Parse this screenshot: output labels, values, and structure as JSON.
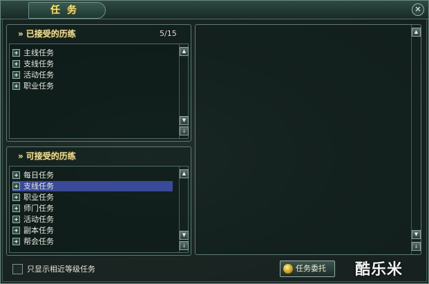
{
  "window": {
    "title": "任务"
  },
  "accepted": {
    "header": "已接受的历练",
    "count": "5/15",
    "items": [
      {
        "label": "主线任务"
      },
      {
        "label": "支线任务"
      },
      {
        "label": "活动任务"
      },
      {
        "label": "职业任务"
      }
    ]
  },
  "available": {
    "header": "可接受的历练",
    "items": [
      {
        "label": "每日任务"
      },
      {
        "label": "支线任务"
      },
      {
        "label": "职业任务"
      },
      {
        "label": "师门任务"
      },
      {
        "label": "活动任务"
      },
      {
        "label": "副本任务"
      },
      {
        "label": "帮会任务"
      }
    ],
    "selected_index": 1
  },
  "footer": {
    "checkbox_label": "只显示相近等级任务",
    "delegate_button": "任务委托"
  },
  "watermark": "酷乐米",
  "icons": {
    "close": "close-icon",
    "expand": "plus-icon",
    "scroll_up": "arrow-up-icon",
    "scroll_down": "arrow-down-icon",
    "scroll_bottom": "arrow-bottom-icon",
    "coin": "gold-coin-icon"
  }
}
